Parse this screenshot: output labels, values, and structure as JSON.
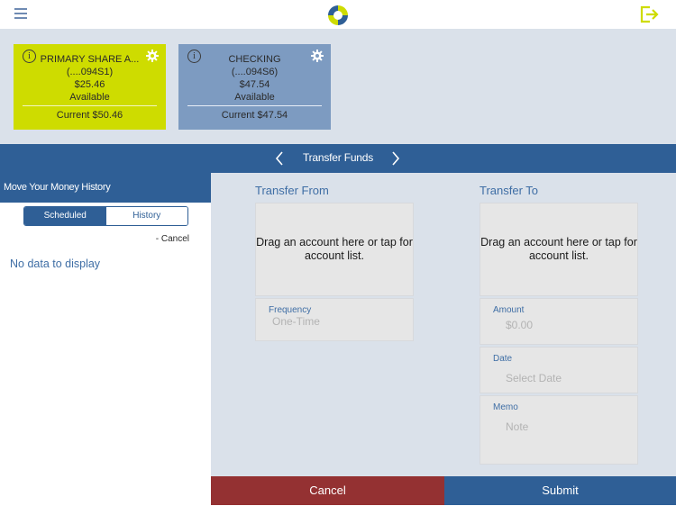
{
  "header": {
    "menu_icon": "hamburger-menu-icon",
    "logo_icon": "brand-logo-icon",
    "logout_icon": "logout-icon"
  },
  "accounts": [
    {
      "name": "PRIMARY SHARE A...",
      "number": "(....094S1)",
      "available_amount": "$25.46",
      "available_label": "Available",
      "current": "Current $50.46",
      "color": "#cedc00"
    },
    {
      "name": "CHECKING",
      "number": "(....094S6)",
      "available_amount": "$47.54",
      "available_label": "Available",
      "current": "Current $47.54",
      "color": "#7d9bc1"
    }
  ],
  "titlebar": {
    "title": "Transfer Funds",
    "prev_icon": "chevron-left-icon",
    "next_icon": "chevron-right-icon"
  },
  "history": {
    "title": "Move Your Money History",
    "tabs": [
      {
        "label": "Scheduled",
        "active": true
      },
      {
        "label": "History",
        "active": false
      }
    ],
    "cancel_link": "- Cancel",
    "empty_message": "No data to display"
  },
  "transfer_from": {
    "title": "Transfer From",
    "drop_text": "Drag an account here or tap for account list.",
    "frequency": {
      "label": "Frequency",
      "value": "One-Time"
    }
  },
  "transfer_to": {
    "title": "Transfer To",
    "drop_text": "Drag an account here or tap for account list.",
    "amount": {
      "label": "Amount",
      "placeholder": "$0.00"
    },
    "date": {
      "label": "Date",
      "placeholder": "Select Date"
    },
    "memo": {
      "label": "Memo",
      "placeholder": "Note"
    }
  },
  "actions": {
    "cancel_label": "Cancel",
    "submit_label": "Submit"
  },
  "colors": {
    "brand_blue": "#2f5f96",
    "brand_lime": "#cedc00",
    "cancel_red": "#943132",
    "panel_bg": "#dae1ea"
  }
}
